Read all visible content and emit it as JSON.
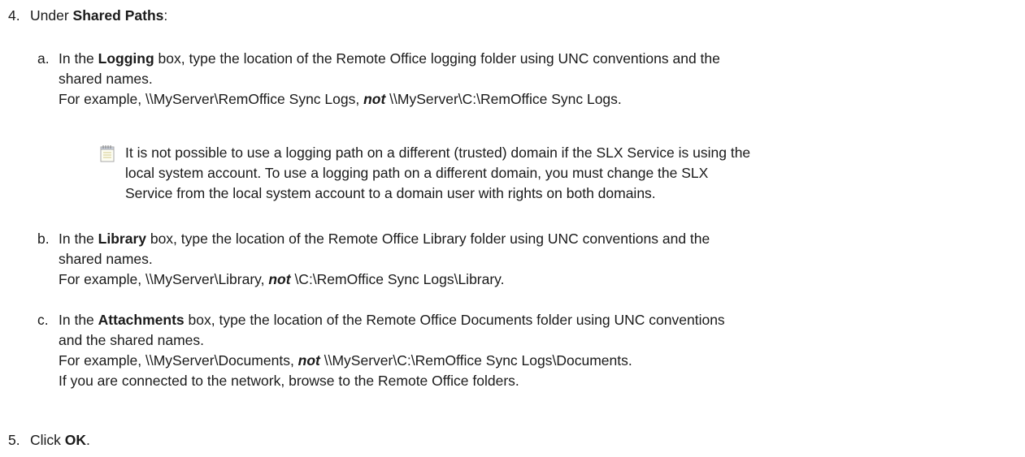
{
  "step4": {
    "number": "4.",
    "prefix": "Under ",
    "bold": "Shared Paths",
    "suffix": ":"
  },
  "sub_a": {
    "letter": "a.",
    "pre": "In the ",
    "bold": "Logging",
    "line1_post": " box, type the location of the Remote Office logging folder using UNC conventions and the",
    "line2": "shared names.",
    "example_pre": "For example, \\\\MyServer\\RemOffice Sync Logs, ",
    "not": "not",
    "example_post": " \\\\MyServer\\C:\\RemOffice Sync Logs."
  },
  "note": {
    "icon": "note-icon",
    "line1": "It is not possible to use a logging path on a different (trusted) domain if the SLX Service is using the",
    "line2": "local system account. To use a logging path on a different domain, you must change the SLX",
    "line3": "Service from the local system account to a domain user with rights on both domains."
  },
  "sub_b": {
    "letter": "b.",
    "pre": "In the ",
    "bold": "Library",
    "line1_post": " box, type the location of the Remote Office Library folder using UNC conventions and the",
    "line2": "shared names.",
    "example_pre": "For example, \\\\MyServer\\Library, ",
    "not": "not",
    "example_post": " \\C:\\RemOffice Sync Logs\\Library."
  },
  "sub_c": {
    "letter": "c.",
    "pre": "In the ",
    "bold": "Attachments",
    "line1_post": " box, type the location of the Remote Office Documents folder using UNC conventions",
    "line2": "and the shared names.",
    "example_pre": "For example, \\\\MyServer\\Documents, ",
    "not": "not",
    "example_post": " \\\\MyServer\\C:\\RemOffice Sync Logs\\Documents.",
    "line4": "If you are connected to the network, browse to the Remote Office folders."
  },
  "step5": {
    "number": "5.",
    "prefix": "Click ",
    "bold": "OK",
    "suffix": "."
  }
}
